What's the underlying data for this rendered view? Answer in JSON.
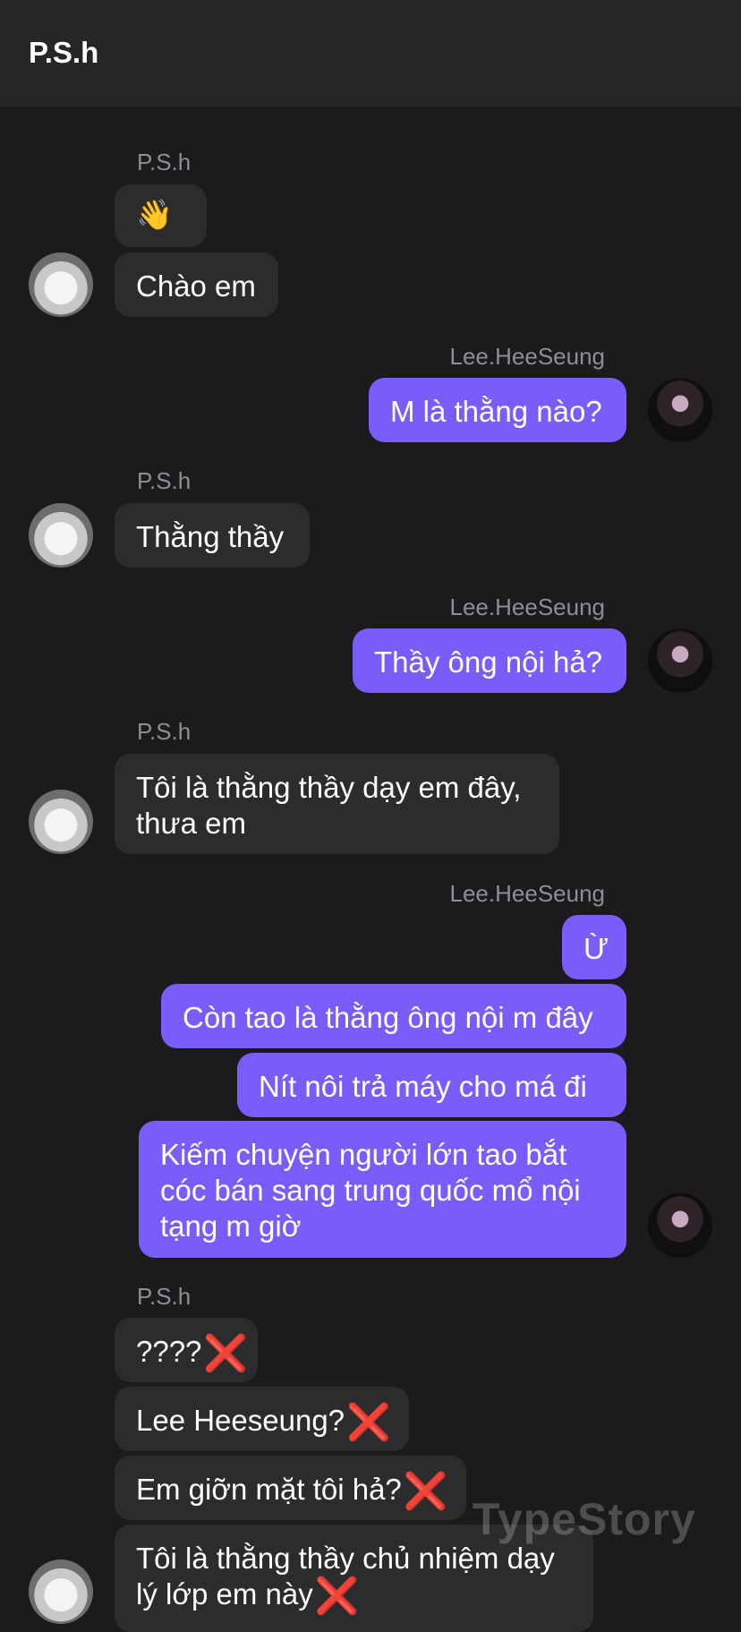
{
  "header": {
    "title": "P.S.h"
  },
  "senders": {
    "left": "P.S.h",
    "right": "Lee.HeeSeung"
  },
  "messages": [
    {
      "id": "m1",
      "text": "👋"
    },
    {
      "id": "m2",
      "text": "Chào em"
    },
    {
      "id": "m3",
      "text": "M là thằng nào?"
    },
    {
      "id": "m4",
      "text": "Thằng thầy"
    },
    {
      "id": "m5",
      "text": "Thầy ông nội hả?"
    },
    {
      "id": "m6",
      "text": "Tôi là thằng thầy dạy em đây, thưa em"
    },
    {
      "id": "m7",
      "text": "Ừ"
    },
    {
      "id": "m8",
      "text": "Còn tao là thằng ông nội m đây"
    },
    {
      "id": "m9",
      "text": "Nít nôi trả máy cho má đi"
    },
    {
      "id": "m10",
      "text": "Kiếm chuyện người lớn tao bắt cóc bán sang trung quốc mổ nội tạng m giờ"
    },
    {
      "id": "m11",
      "text": "????"
    },
    {
      "id": "m12",
      "text": "Lee Heeseung?"
    },
    {
      "id": "m13",
      "text": "Em giỡn mặt tôi hả?"
    },
    {
      "id": "m14",
      "text": "Tôi là thằng thầy chủ nhiệm dạy lý lớp em này"
    }
  ],
  "icons": {
    "cross": "❌",
    "cross_name": "cross-mark-icon"
  },
  "colors": {
    "outgoing": "#7a5cfa",
    "incoming": "#2c2c2e",
    "background": "#1b1b1d",
    "cross": "#e2262b"
  },
  "watermark": "TypeStory"
}
